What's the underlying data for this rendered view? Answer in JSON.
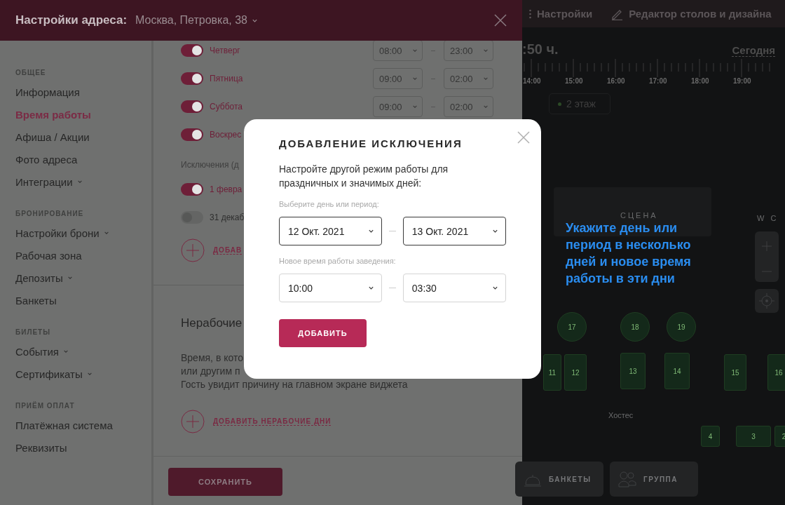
{
  "drawer": {
    "title": "Настройки адреса:",
    "address": "Москва, Петровка, 38"
  },
  "sidebar": {
    "sections": [
      {
        "label": "ОБЩЕЕ",
        "items": [
          {
            "label": "Информация",
            "selected": false,
            "expandable": false
          },
          {
            "label": "Время работы",
            "selected": true,
            "expandable": false
          },
          {
            "label": "Афиша / Акции",
            "selected": false,
            "expandable": false
          },
          {
            "label": "Фото адреса",
            "selected": false,
            "expandable": false
          },
          {
            "label": "Интеграции",
            "selected": false,
            "expandable": true
          }
        ]
      },
      {
        "label": "БРОНИРОВАНИЕ",
        "items": [
          {
            "label": "Настройки брони",
            "selected": false,
            "expandable": true
          },
          {
            "label": "Рабочая зона",
            "selected": false,
            "expandable": false
          },
          {
            "label": "Депозиты",
            "selected": false,
            "expandable": true
          },
          {
            "label": "Банкеты",
            "selected": false,
            "expandable": false
          }
        ]
      },
      {
        "label": "БИЛЕТЫ",
        "items": [
          {
            "label": "События",
            "selected": false,
            "expandable": true
          },
          {
            "label": "Сертификаты",
            "selected": false,
            "expandable": true
          }
        ]
      },
      {
        "label": "ПРИЁМ ОПЛАТ",
        "items": [
          {
            "label": "Платёжная система",
            "selected": false,
            "expandable": false
          },
          {
            "label": "Реквизиты",
            "selected": false,
            "expandable": false
          }
        ]
      }
    ]
  },
  "schedule": {
    "days": [
      {
        "label": "Четверг",
        "on": true,
        "from": "08:00",
        "to": "23:00"
      },
      {
        "label": "Пятница",
        "on": true,
        "from": "09:00",
        "to": "02:00"
      },
      {
        "label": "Суббота",
        "on": true,
        "from": "09:00",
        "to": "02:00"
      },
      {
        "label": "Воскрес",
        "on": true
      }
    ],
    "exceptions_label": "Исключения (д",
    "exceptions": [
      {
        "label": "1 февра",
        "on": true
      },
      {
        "label": "31 декаб",
        "on": false
      }
    ],
    "add_link": "ДОБАВ"
  },
  "non_working": {
    "heading": "Нерабочие",
    "lines": [
      "Время, в кото",
      "или другим п",
      "Гость увидит причину на главном экране виджета"
    ],
    "add_link": "ДОБАВИТЬ НЕРАБОЧИЕ ДНИ"
  },
  "save_button": "СОХРАНИТЬ",
  "app": {
    "nav": [
      {
        "label": "Настройки",
        "kind": "settings"
      },
      {
        "label": "Редактор столов и дизайна",
        "kind": "editor"
      }
    ],
    "time": ":50 ч.",
    "today": "Сегодня",
    "timeline": [
      "14:00",
      "15:00",
      "16:00",
      "17:00",
      "18:00",
      "19:00"
    ],
    "floor_tab": "2 этаж",
    "zones": [
      "СЦЕНА",
      "W C",
      "Хостес"
    ],
    "tables": [
      {
        "number": "17",
        "kind": "round"
      },
      {
        "number": "18",
        "kind": "round"
      },
      {
        "number": "19",
        "kind": "round"
      },
      {
        "number": "11",
        "kind": "sofa"
      },
      {
        "number": "12",
        "kind": "sofa"
      },
      {
        "number": "13",
        "kind": "chairs"
      },
      {
        "number": "14",
        "kind": "chairs"
      },
      {
        "number": "15",
        "kind": "sofa"
      },
      {
        "number": "16",
        "kind": "sofa"
      },
      {
        "number": "4",
        "kind": "bar"
      },
      {
        "number": "3",
        "kind": "bar"
      },
      {
        "number": "2",
        "kind": "bar"
      }
    ],
    "bottom_buttons": [
      {
        "label": "БАНКЕТЫ",
        "kind": "banquet"
      },
      {
        "label": "ГРУППА",
        "kind": "group"
      }
    ]
  },
  "modal": {
    "title": "ДОБАВЛЕНИЕ ИСКЛЮЧЕНИЯ",
    "description": "Настройте другой режим работы для праздничных и значимых дней:",
    "period_label": "Выберите день или период:",
    "date_from": "12 Окт. 2021",
    "date_to": "13 Окт. 2021",
    "time_label": "Новое время работы заведения:",
    "time_from": "10:00",
    "time_to": "03:30",
    "button": "ДОБАВИТЬ"
  },
  "hint": "Укажите день или период в несколько дней и новое время работы в эти дни"
}
